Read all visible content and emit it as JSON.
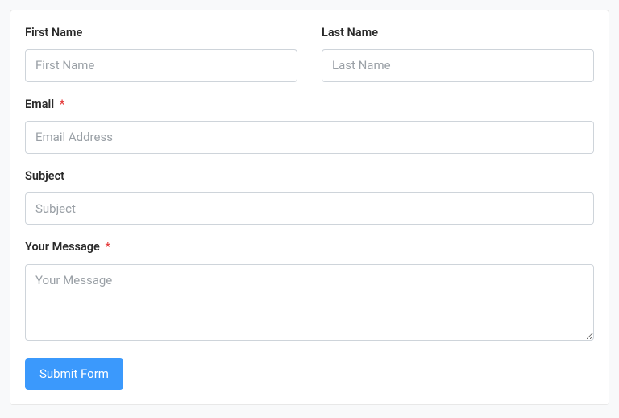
{
  "fields": {
    "first_name": {
      "label": "First Name",
      "placeholder": "First Name",
      "value": ""
    },
    "last_name": {
      "label": "Last Name",
      "placeholder": "Last Name",
      "value": ""
    },
    "email": {
      "label": "Email",
      "placeholder": "Email Address",
      "value": "",
      "required_mark": "*"
    },
    "subject": {
      "label": "Subject",
      "placeholder": "Subject",
      "value": ""
    },
    "message": {
      "label": "Your Message",
      "placeholder": "Your Message",
      "value": "",
      "required_mark": "*"
    }
  },
  "submit": {
    "label": "Submit Form"
  }
}
